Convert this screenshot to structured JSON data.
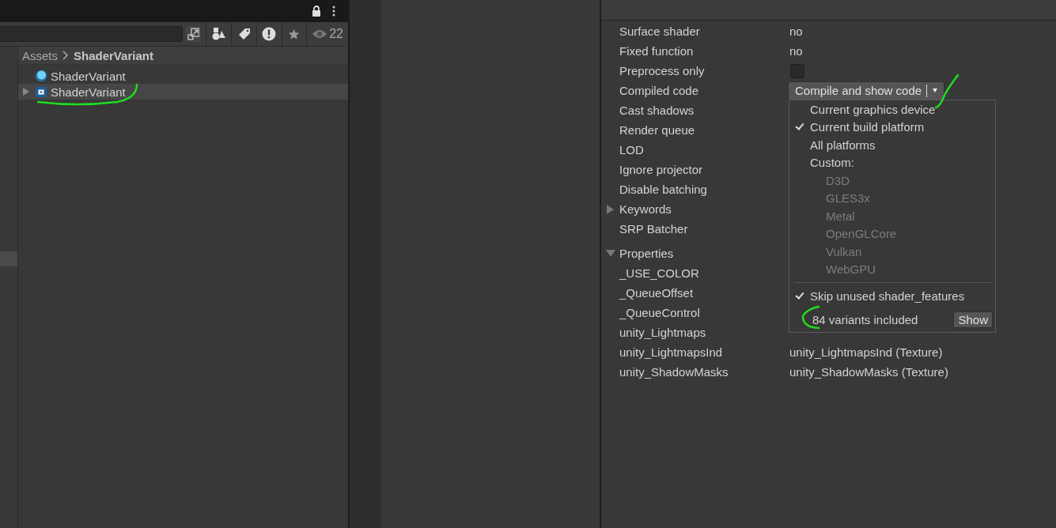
{
  "project": {
    "toolbar": {
      "count": "22"
    },
    "breadcrumb": [
      "Assets",
      "ShaderVariant"
    ],
    "items": [
      {
        "label": "ShaderVariant",
        "kind": "shader",
        "selected": false,
        "expandable": false
      },
      {
        "label": "ShaderVariant",
        "kind": "variant",
        "selected": true,
        "expandable": true
      }
    ]
  },
  "inspector": {
    "rows": [
      {
        "label": "Surface shader",
        "kind": "text",
        "value": "no"
      },
      {
        "label": "Fixed function",
        "kind": "text",
        "value": "no"
      },
      {
        "label": "Preprocess only",
        "kind": "checkbox",
        "checked": false
      },
      {
        "label": "Compiled code",
        "kind": "dropdown",
        "value": "Compile and show code"
      },
      {
        "label": "Cast shadows",
        "kind": "text"
      },
      {
        "label": "Render queue",
        "kind": "text"
      },
      {
        "label": "LOD",
        "kind": "text"
      },
      {
        "label": "Ignore projector",
        "kind": "text"
      },
      {
        "label": "Disable batching",
        "kind": "text"
      },
      {
        "label": "Keywords",
        "kind": "foldout",
        "expanded": false
      },
      {
        "label": "SRP Batcher",
        "kind": "text"
      },
      {
        "label": "Properties",
        "kind": "foldout",
        "expanded": true,
        "children": [
          {
            "label": "_USE_COLOR"
          },
          {
            "label": "_QueueOffset"
          },
          {
            "label": "_QueueControl"
          },
          {
            "label": "unity_Lightmaps"
          },
          {
            "label": "unity_LightmapsInd",
            "value": "unity_LightmapsInd (Texture)"
          },
          {
            "label": "unity_ShadowMasks",
            "value": "unity_ShadowMasks (Texture)"
          }
        ]
      }
    ]
  },
  "menu": {
    "items": [
      {
        "label": "Current graphics device",
        "kind": "option",
        "checked": false
      },
      {
        "label": "Current build platform",
        "kind": "option",
        "checked": true
      },
      {
        "label": "All platforms",
        "kind": "option",
        "checked": false
      },
      {
        "label": "Custom:",
        "kind": "header",
        "children": [
          {
            "label": "D3D",
            "disabled": true
          },
          {
            "label": "GLES3x",
            "disabled": true
          },
          {
            "label": "Metal",
            "disabled": true
          },
          {
            "label": "OpenGLCore",
            "disabled": true
          },
          {
            "label": "Vulkan",
            "disabled": true
          },
          {
            "label": "WebGPU",
            "disabled": true
          }
        ]
      },
      {
        "kind": "separator"
      },
      {
        "label": "Skip unused shader_features",
        "kind": "option",
        "checked": true
      }
    ],
    "footer": {
      "text": "84 variants included",
      "button": "Show"
    }
  }
}
